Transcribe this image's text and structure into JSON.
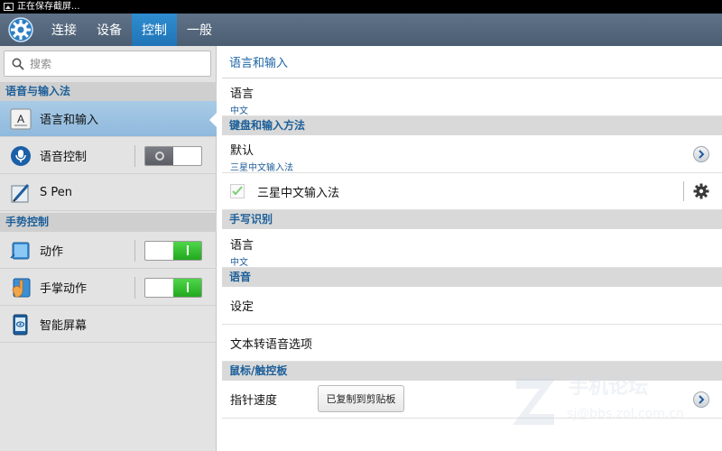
{
  "status_bar": {
    "text": "正在保存截屏...",
    "icon": "image-icon"
  },
  "tabs": [
    {
      "label": "连接",
      "active": false
    },
    {
      "label": "设备",
      "active": false
    },
    {
      "label": "控制",
      "active": true
    },
    {
      "label": "一般",
      "active": false
    }
  ],
  "search": {
    "placeholder": "搜索"
  },
  "left": {
    "sections": [
      {
        "title": "语音与输入法",
        "items": [
          {
            "label": "语言和输入",
            "icon": "keyboard-a-icon",
            "selected": true
          },
          {
            "label": "语音控制",
            "icon": "microphone-icon",
            "toggle": "off"
          },
          {
            "label": "S Pen",
            "icon": "pen-icon"
          }
        ]
      },
      {
        "title": "手势控制",
        "items": [
          {
            "label": "动作",
            "icon": "motion-icon",
            "toggle": "on"
          },
          {
            "label": "手掌动作",
            "icon": "palm-icon",
            "toggle": "on"
          },
          {
            "label": "智能屏幕",
            "icon": "smart-screen-icon"
          }
        ]
      }
    ]
  },
  "right": {
    "title": "语言和输入",
    "language": {
      "label": "语言",
      "value": "中文"
    },
    "keyboard_section": "键盘和输入方法",
    "default": {
      "label": "默认",
      "value": "三星中文输入法"
    },
    "samsung_ime": {
      "label": "三星中文输入法",
      "checked": true
    },
    "handwriting_section": "手写识别",
    "handwriting_language": {
      "label": "语言",
      "value": "中文"
    },
    "voice_section": "语音",
    "voice_settings": {
      "label": "设定"
    },
    "tts": {
      "label": "文本转语音选项"
    },
    "pointer_section": "鼠标/触控板",
    "pointer_speed": {
      "label": "指针速度"
    },
    "toast": "已复制到剪贴板"
  },
  "watermark": {
    "line1": "手机论坛",
    "line2": "sj@bbs.zol.com.cn"
  },
  "colors": {
    "accent": "#1e66a6",
    "tab_active": "#2f8dd0",
    "toggle_on": "#22a81e",
    "selected": "#8fb9dd"
  }
}
